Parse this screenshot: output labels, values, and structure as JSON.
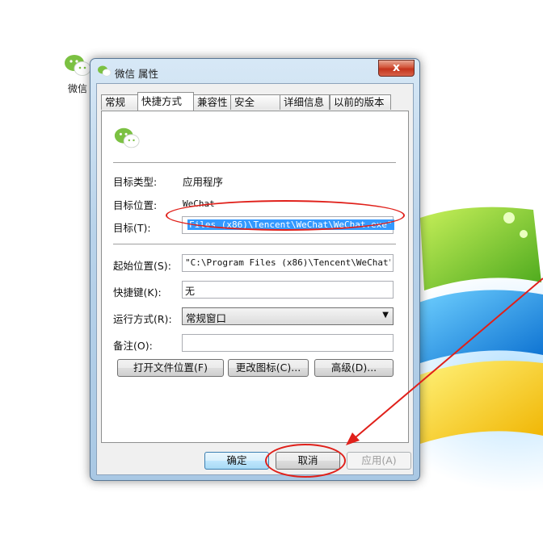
{
  "desktop": {
    "icon_label": "微信"
  },
  "window": {
    "title": "微信 属性",
    "close_glyph": "x"
  },
  "tabs": [
    {
      "label": "常规"
    },
    {
      "label": "快捷方式"
    },
    {
      "label": "兼容性"
    },
    {
      "label": "安全"
    },
    {
      "label": "详细信息"
    },
    {
      "label": "以前的版本"
    }
  ],
  "shortcut": {
    "target_type_label": "目标类型:",
    "target_type_value": "应用程序",
    "target_location_label": "目标位置:",
    "target_location_value": "WeChat",
    "target_label": "目标(T):",
    "target_value": "Files (x86)\\Tencent\\WeChat\\WeChat.exe\"",
    "start_in_label": "起始位置(S):",
    "start_in_value": "\"C:\\Program Files (x86)\\Tencent\\WeChat\"",
    "shortcut_key_label": "快捷键(K):",
    "shortcut_key_value": "无",
    "run_label": "运行方式(R):",
    "run_value": "常规窗口",
    "comment_label": "备注(O):",
    "comment_value": "",
    "open_location_button": "打开文件位置(F)",
    "change_icon_button": "更改图标(C)...",
    "advanced_button": "高级(D)..."
  },
  "footer": {
    "ok": "确定",
    "cancel": "取消",
    "apply": "应用(A)"
  },
  "colors": {
    "annotation_red": "#e0201a",
    "selection_blue": "#3399ff",
    "wechat_green": "#7bc142"
  }
}
